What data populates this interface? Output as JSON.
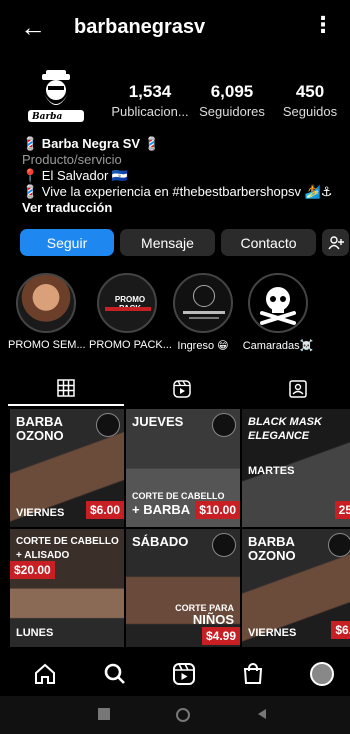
{
  "header": {
    "username": "barbanegrasv",
    "back_icon": "arrow-left-icon",
    "menu_icon": "kebab-icon"
  },
  "profile": {
    "logo_text": "Barba Negra",
    "stats": [
      {
        "value": "1,534",
        "label": "Publicacion..."
      },
      {
        "value": "6,095",
        "label": "Seguidores"
      },
      {
        "value": "450",
        "label": "Seguidos"
      }
    ],
    "bio": {
      "name": "💈 Barba Negra SV 💈",
      "category": "Producto/servicio",
      "location": "📍 El Salvador 🇸🇻",
      "tagline": "💈 Vive la experiencia en #thebestbarbershopsv 🏄⚓",
      "translate": "Ver traducción"
    }
  },
  "actions": {
    "follow": "Seguir",
    "message": "Mensaje",
    "contact": "Contacto",
    "add_person_icon": "add-person-icon"
  },
  "highlights": [
    {
      "label": "PROMO SEM..."
    },
    {
      "label": "PROMO PACK...",
      "inner": "PROMO PACK"
    },
    {
      "label": "Ingreso 😁"
    },
    {
      "label": "Camaradas☠️"
    }
  ],
  "tabs": [
    {
      "icon": "grid-icon",
      "active": true
    },
    {
      "icon": "reels-icon",
      "active": false
    },
    {
      "icon": "tagged-icon",
      "active": false
    }
  ],
  "posts": [
    {
      "title": "BARBA\nOZONO",
      "day": "VIERNES",
      "price": "$6.00"
    },
    {
      "title": "JUEVES",
      "sub": "CORTE DE CABELLO",
      "sub2": "+ BARBA",
      "price": "$10.00"
    },
    {
      "title": "BLACK MASK\nELEGANCE",
      "day": "MARTES",
      "price": "25"
    },
    {
      "title": "CORTE DE CABELLO\n+ ALISADO",
      "price": "$20.00",
      "day": "LUNES"
    },
    {
      "title": "SÁBADO",
      "sub": "CORTE PARA",
      "sub2": "NIÑOS",
      "price": "$4.99"
    },
    {
      "title": "BARBA\nOZONO",
      "day": "VIERNES",
      "price": "$6."
    }
  ],
  "nav": [
    "home-icon",
    "search-icon",
    "reels-icon",
    "shop-icon",
    "profile-avatar-icon"
  ],
  "colors": {
    "accent": "#1e87f0",
    "price_bg": "#c81f25"
  }
}
